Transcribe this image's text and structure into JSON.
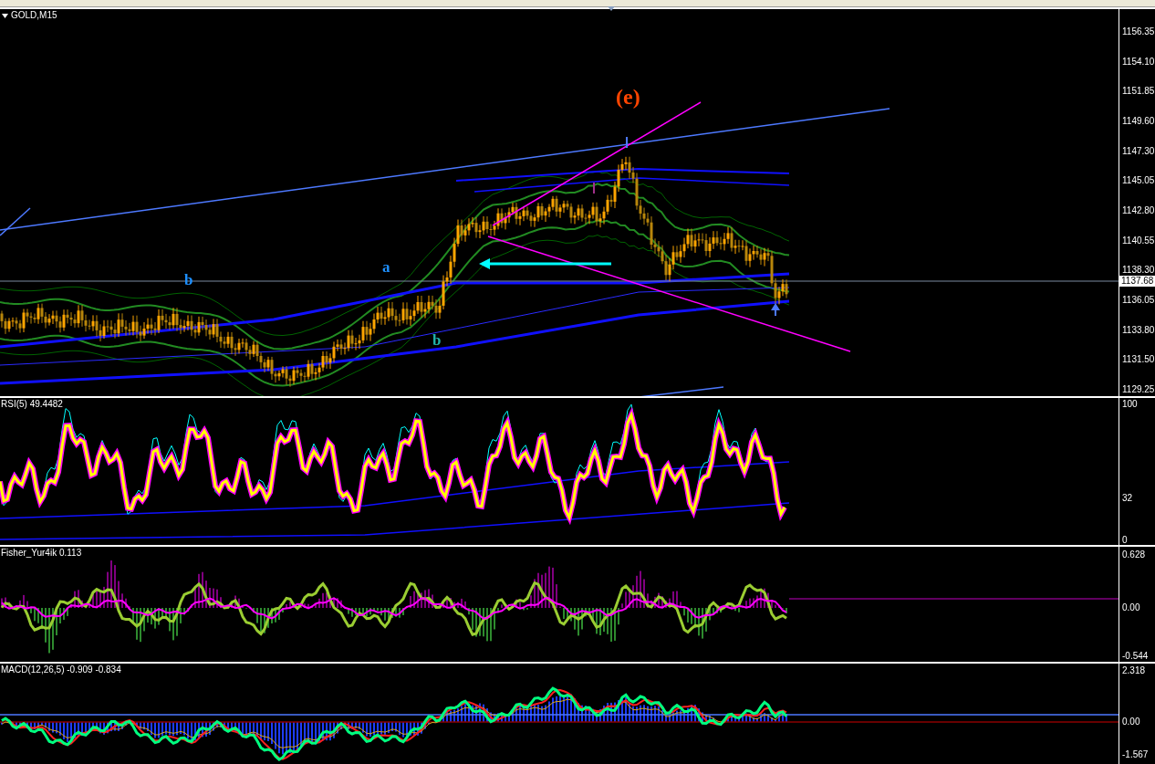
{
  "chart": {
    "title": "GOLD,M15",
    "price_axis": [
      "1156.35",
      "1154.10",
      "1151.85",
      "1149.60",
      "1147.30",
      "1145.05",
      "1142.80",
      "1140.55",
      "1138.30",
      "1136.05",
      "1133.80",
      "1131.50",
      "1129.25"
    ],
    "current_price": "1137.68",
    "wave_labels": [
      {
        "text": "(e)",
        "color": "#ff4500"
      },
      {
        "text": "a",
        "color": "#1e90ff"
      },
      {
        "text": "b",
        "color": "#1e90ff"
      },
      {
        "text": "b",
        "color": "#20b2aa"
      }
    ]
  },
  "indicators": [
    {
      "kind": "rsi",
      "label": "RSI(5) 49.4482",
      "axis": [
        "100",
        "32",
        "0"
      ]
    },
    {
      "kind": "fisher",
      "label": "Fisher_Yur4ik 0.113",
      "axis": [
        "0.628",
        "0.00",
        "-0.544"
      ]
    },
    {
      "kind": "macd",
      "label": "MACD(12,26,5) -0.909 -0.834",
      "axis": [
        "2.318",
        "0.00",
        "-1.567"
      ]
    }
  ]
}
